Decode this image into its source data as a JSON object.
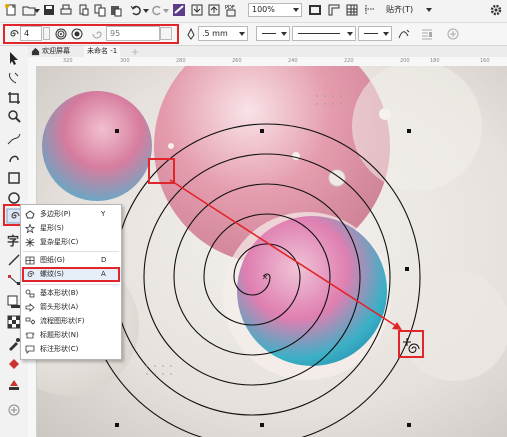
{
  "toolbar": {
    "zoom_value": "100%",
    "snap_label": "贴齐(T)"
  },
  "property_bar": {
    "spiral_revolutions": "4",
    "expansion_value": "95",
    "outline_width": ".5 mm"
  },
  "document_tabs": [
    {
      "label": "欢迎屏幕"
    },
    {
      "label": "未命名 -1"
    }
  ],
  "ruler": {
    "ticks": [
      "320",
      "300",
      "280",
      "260",
      "240",
      "220",
      "200",
      "180",
      "160"
    ]
  },
  "flyout_menu": {
    "items": [
      {
        "label": "多边形(P)",
        "shortcut": "Y",
        "icon": "polygon-icon"
      },
      {
        "label": "星形(S)",
        "shortcut": "",
        "icon": "star-icon"
      },
      {
        "label": "复杂星形(C)",
        "shortcut": "",
        "icon": "complex-star-icon"
      },
      {
        "label": "图纸(G)",
        "shortcut": "D",
        "icon": "graph-paper-icon"
      },
      {
        "label": "螺纹(S)",
        "shortcut": "A",
        "icon": "spiral-icon"
      },
      {
        "label": "基本形状(B)",
        "shortcut": "",
        "icon": "basic-shapes-icon"
      },
      {
        "label": "箭头形状(A)",
        "shortcut": "",
        "icon": "arrow-shapes-icon"
      },
      {
        "label": "流程图形状(F)",
        "shortcut": "",
        "icon": "flowchart-shapes-icon"
      },
      {
        "label": "标题形状(N)",
        "shortcut": "",
        "icon": "banner-shapes-icon"
      },
      {
        "label": "标注形状(C)",
        "shortcut": "",
        "icon": "callout-shapes-icon"
      }
    ],
    "selected_index": 4
  },
  "colors": {
    "highlight_red": "#e0262a",
    "arrow_red": "#e0262a"
  }
}
